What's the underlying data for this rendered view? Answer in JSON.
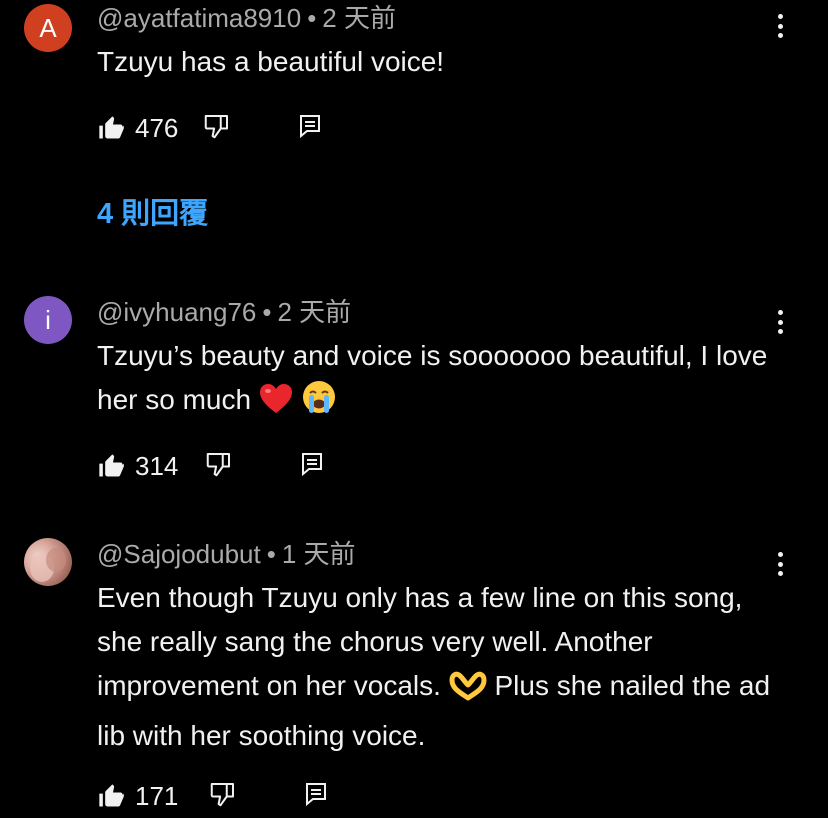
{
  "comments": [
    {
      "avatar_letter": "A",
      "avatar_color": "#d13f21",
      "username": "@ayatfatima8910",
      "separator": "•",
      "time": "2 天前",
      "text": "Tzuyu has a beautiful voice!",
      "likes": "476",
      "replies_label": "4 則回覆"
    },
    {
      "avatar_letter": "i",
      "avatar_color": "#7e57c2",
      "username": "@ivyhuang76",
      "separator": "•",
      "time": "2 天前",
      "text": "Tzuyu’s beauty and voice is sooooooo beautiful, I love her so much",
      "likes": "314"
    },
    {
      "username": "@Sajojodubut",
      "separator": "•",
      "time": "1 天前",
      "text_line1": "Even though Tzuyu only has a few line on this song, she really sang the chorus very well. Another improvement on her vocals.",
      "text_line2": "Plus she nailed the ad lib with her soothing voice.",
      "likes": "171"
    }
  ],
  "icons": {
    "like": "thumbs-up-icon",
    "dislike": "thumbs-down-icon",
    "reply": "reply-comment-icon",
    "more": "more-vertical-icon"
  },
  "colors": {
    "background": "#000000",
    "text": "#f1f1f1",
    "meta": "#aaaaaa",
    "link": "#3ea6ff"
  }
}
